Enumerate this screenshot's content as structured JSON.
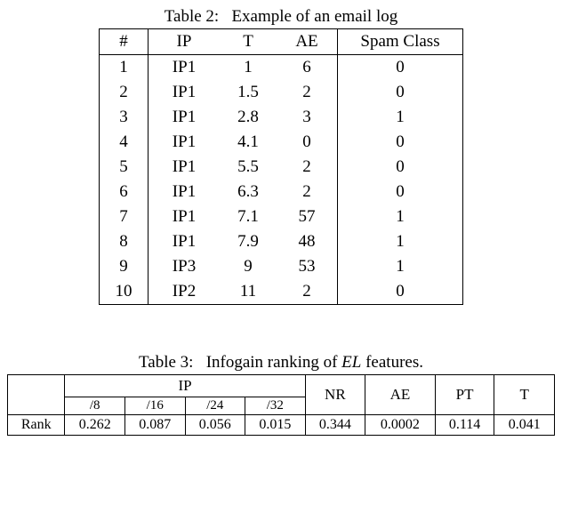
{
  "table2": {
    "caption_prefix": "Table 2:",
    "caption_text": "Example of an email log",
    "headers": {
      "num": "#",
      "ip": "IP",
      "t": "T",
      "ae": "AE",
      "spam": "Spam Class"
    },
    "rows": [
      {
        "num": "1",
        "ip": "IP1",
        "t": "1",
        "ae": "6",
        "spam": "0"
      },
      {
        "num": "2",
        "ip": "IP1",
        "t": "1.5",
        "ae": "2",
        "spam": "0"
      },
      {
        "num": "3",
        "ip": "IP1",
        "t": "2.8",
        "ae": "3",
        "spam": "1"
      },
      {
        "num": "4",
        "ip": "IP1",
        "t": "4.1",
        "ae": "0",
        "spam": "0"
      },
      {
        "num": "5",
        "ip": "IP1",
        "t": "5.5",
        "ae": "2",
        "spam": "0"
      },
      {
        "num": "6",
        "ip": "IP1",
        "t": "6.3",
        "ae": "2",
        "spam": "0"
      },
      {
        "num": "7",
        "ip": "IP1",
        "t": "7.1",
        "ae": "57",
        "spam": "1"
      },
      {
        "num": "8",
        "ip": "IP1",
        "t": "7.9",
        "ae": "48",
        "spam": "1"
      },
      {
        "num": "9",
        "ip": "IP3",
        "t": "9",
        "ae": "53",
        "spam": "1"
      },
      {
        "num": "10",
        "ip": "IP2",
        "t": "11",
        "ae": "2",
        "spam": "0"
      }
    ]
  },
  "table3": {
    "caption_prefix": "Table 3:",
    "caption_text_a": "Infogain ranking of ",
    "caption_text_el": "EL",
    "caption_text_b": " features.",
    "headers": {
      "blank": "",
      "ip": "IP",
      "ip8": "/8",
      "ip16": "/16",
      "ip24": "/24",
      "ip32": "/32",
      "nr": "NR",
      "ae": "AE",
      "pt": "PT",
      "t": "T"
    },
    "rank_label": "Rank",
    "values": {
      "ip8": "0.262",
      "ip16": "0.087",
      "ip24": "0.056",
      "ip32": "0.015",
      "nr": "0.344",
      "ae": "0.0002",
      "pt": "0.114",
      "t": "0.041"
    }
  },
  "chart_data": [
    {
      "type": "table",
      "title": "Example of an email log",
      "columns": [
        "#",
        "IP",
        "T",
        "AE",
        "Spam Class"
      ],
      "rows": [
        [
          1,
          "IP1",
          1,
          6,
          0
        ],
        [
          2,
          "IP1",
          1.5,
          2,
          0
        ],
        [
          3,
          "IP1",
          2.8,
          3,
          1
        ],
        [
          4,
          "IP1",
          4.1,
          0,
          0
        ],
        [
          5,
          "IP1",
          5.5,
          2,
          0
        ],
        [
          6,
          "IP1",
          6.3,
          2,
          0
        ],
        [
          7,
          "IP1",
          7.1,
          57,
          1
        ],
        [
          8,
          "IP1",
          7.9,
          48,
          1
        ],
        [
          9,
          "IP3",
          9,
          53,
          1
        ],
        [
          10,
          "IP2",
          11,
          2,
          0
        ]
      ]
    },
    {
      "type": "table",
      "title": "Infogain ranking of EL features.",
      "columns": [
        "",
        "IP /8",
        "IP /16",
        "IP /24",
        "IP /32",
        "NR",
        "AE",
        "PT",
        "T"
      ],
      "rows": [
        [
          "Rank",
          0.262,
          0.087,
          0.056,
          0.015,
          0.344,
          0.0002,
          0.114,
          0.041
        ]
      ]
    }
  ]
}
